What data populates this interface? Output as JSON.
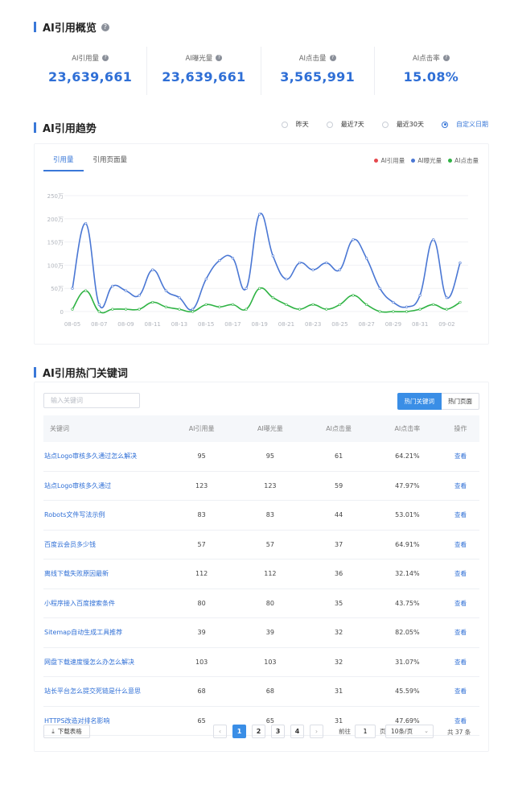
{
  "overview": {
    "title": "AI引用概览",
    "metrics": [
      {
        "label": "AI引用量",
        "value": "23,639,661"
      },
      {
        "label": "AI曝光量",
        "value": "23,639,661"
      },
      {
        "label": "AI点击量",
        "value": "3,565,991"
      },
      {
        "label": "AI点击率",
        "value": "15.08%"
      }
    ]
  },
  "trend": {
    "title": "AI引用趋势",
    "ranges": [
      "昨天",
      "最近7天",
      "最近30天",
      "自定义日期"
    ],
    "selected_range": "自定义日期",
    "tabs": [
      "引用量",
      "引用页面量"
    ],
    "legend": [
      {
        "name": "AI引用量",
        "color": "#e5484d"
      },
      {
        "name": "AI曝光量",
        "color": "#4a77d4"
      },
      {
        "name": "AI点击量",
        "color": "#2fb344"
      }
    ]
  },
  "chart_data": {
    "type": "line",
    "x": [
      "08-05",
      "08-06",
      "08-07",
      "08-08",
      "08-09",
      "08-10",
      "08-11",
      "08-12",
      "08-13",
      "08-14",
      "08-15",
      "08-16",
      "08-17",
      "08-18",
      "08-19",
      "08-20",
      "08-21",
      "08-22",
      "08-23",
      "08-24",
      "08-25",
      "08-26",
      "08-27",
      "08-28",
      "08-29",
      "08-30",
      "08-31",
      "09-01",
      "09-02",
      "09-03"
    ],
    "x_tick_labels": [
      "08-05",
      "08-07",
      "08-09",
      "08-11",
      "08-13",
      "08-15",
      "08-17",
      "08-19",
      "08-21",
      "08-23",
      "08-25",
      "08-27",
      "08-29",
      "08-31",
      "09-02"
    ],
    "y_tick_labels": [
      "0",
      "50万",
      "100万",
      "150万",
      "200万",
      "250万"
    ],
    "ylim": [
      0,
      250
    ],
    "y_unit": "万",
    "series": [
      {
        "name": "AI曝光量",
        "color": "#4a77d4",
        "values": [
          50,
          190,
          15,
          55,
          45,
          35,
          90,
          45,
          30,
          5,
          70,
          110,
          115,
          50,
          210,
          120,
          70,
          105,
          90,
          105,
          90,
          155,
          115,
          50,
          20,
          10,
          35,
          155,
          30,
          105
        ]
      },
      {
        "name": "AI点击量",
        "color": "#2fb344",
        "values": [
          5,
          45,
          0,
          5,
          5,
          5,
          20,
          10,
          5,
          0,
          15,
          10,
          15,
          5,
          50,
          30,
          15,
          5,
          15,
          5,
          15,
          35,
          15,
          0,
          0,
          0,
          5,
          15,
          5,
          20
        ]
      }
    ]
  },
  "keywords": {
    "title": "AI引用热门关键词",
    "search_placeholder": "输入关键词",
    "seg_buttons": [
      "热门关键词",
      "热门页面"
    ],
    "columns": [
      "关键词",
      "AI引用量",
      "AI曝光量",
      "AI点击量",
      "AI点击率",
      "操作"
    ],
    "rows": [
      {
        "kw": "站点Logo审核多久通过怎么解决",
        "ref": "95",
        "exp": "95",
        "clk": "61",
        "rate": "64.21%",
        "op": "查看"
      },
      {
        "kw": "站点Logo审核多久通过",
        "ref": "123",
        "exp": "123",
        "clk": "59",
        "rate": "47.97%",
        "op": "查看"
      },
      {
        "kw": "Robots文件写法示例",
        "ref": "83",
        "exp": "83",
        "clk": "44",
        "rate": "53.01%",
        "op": "查看"
      },
      {
        "kw": "百度云会员多少钱",
        "ref": "57",
        "exp": "57",
        "clk": "37",
        "rate": "64.91%",
        "op": "查看"
      },
      {
        "kw": "离线下载失败原因最新",
        "ref": "112",
        "exp": "112",
        "clk": "36",
        "rate": "32.14%",
        "op": "查看"
      },
      {
        "kw": "小程序接入百度搜索条件",
        "ref": "80",
        "exp": "80",
        "clk": "35",
        "rate": "43.75%",
        "op": "查看"
      },
      {
        "kw": "Sitemap自动生成工具推荐",
        "ref": "39",
        "exp": "39",
        "clk": "32",
        "rate": "82.05%",
        "op": "查看"
      },
      {
        "kw": "网盘下载速度慢怎么办怎么解决",
        "ref": "103",
        "exp": "103",
        "clk": "32",
        "rate": "31.07%",
        "op": "查看"
      },
      {
        "kw": "站长平台怎么提交死链是什么意思",
        "ref": "68",
        "exp": "68",
        "clk": "31",
        "rate": "45.59%",
        "op": "查看"
      },
      {
        "kw": "HTTPS改造对排名影响",
        "ref": "65",
        "exp": "65",
        "clk": "31",
        "rate": "47.69%",
        "op": "查看"
      }
    ],
    "download_label": "下载表格",
    "pages": [
      "1",
      "2",
      "3",
      "4"
    ],
    "current_page": "1",
    "goto_prefix": "前往",
    "goto_value": "1",
    "goto_suffix": "页",
    "page_size": "10条/页",
    "total": "共 37 条"
  }
}
